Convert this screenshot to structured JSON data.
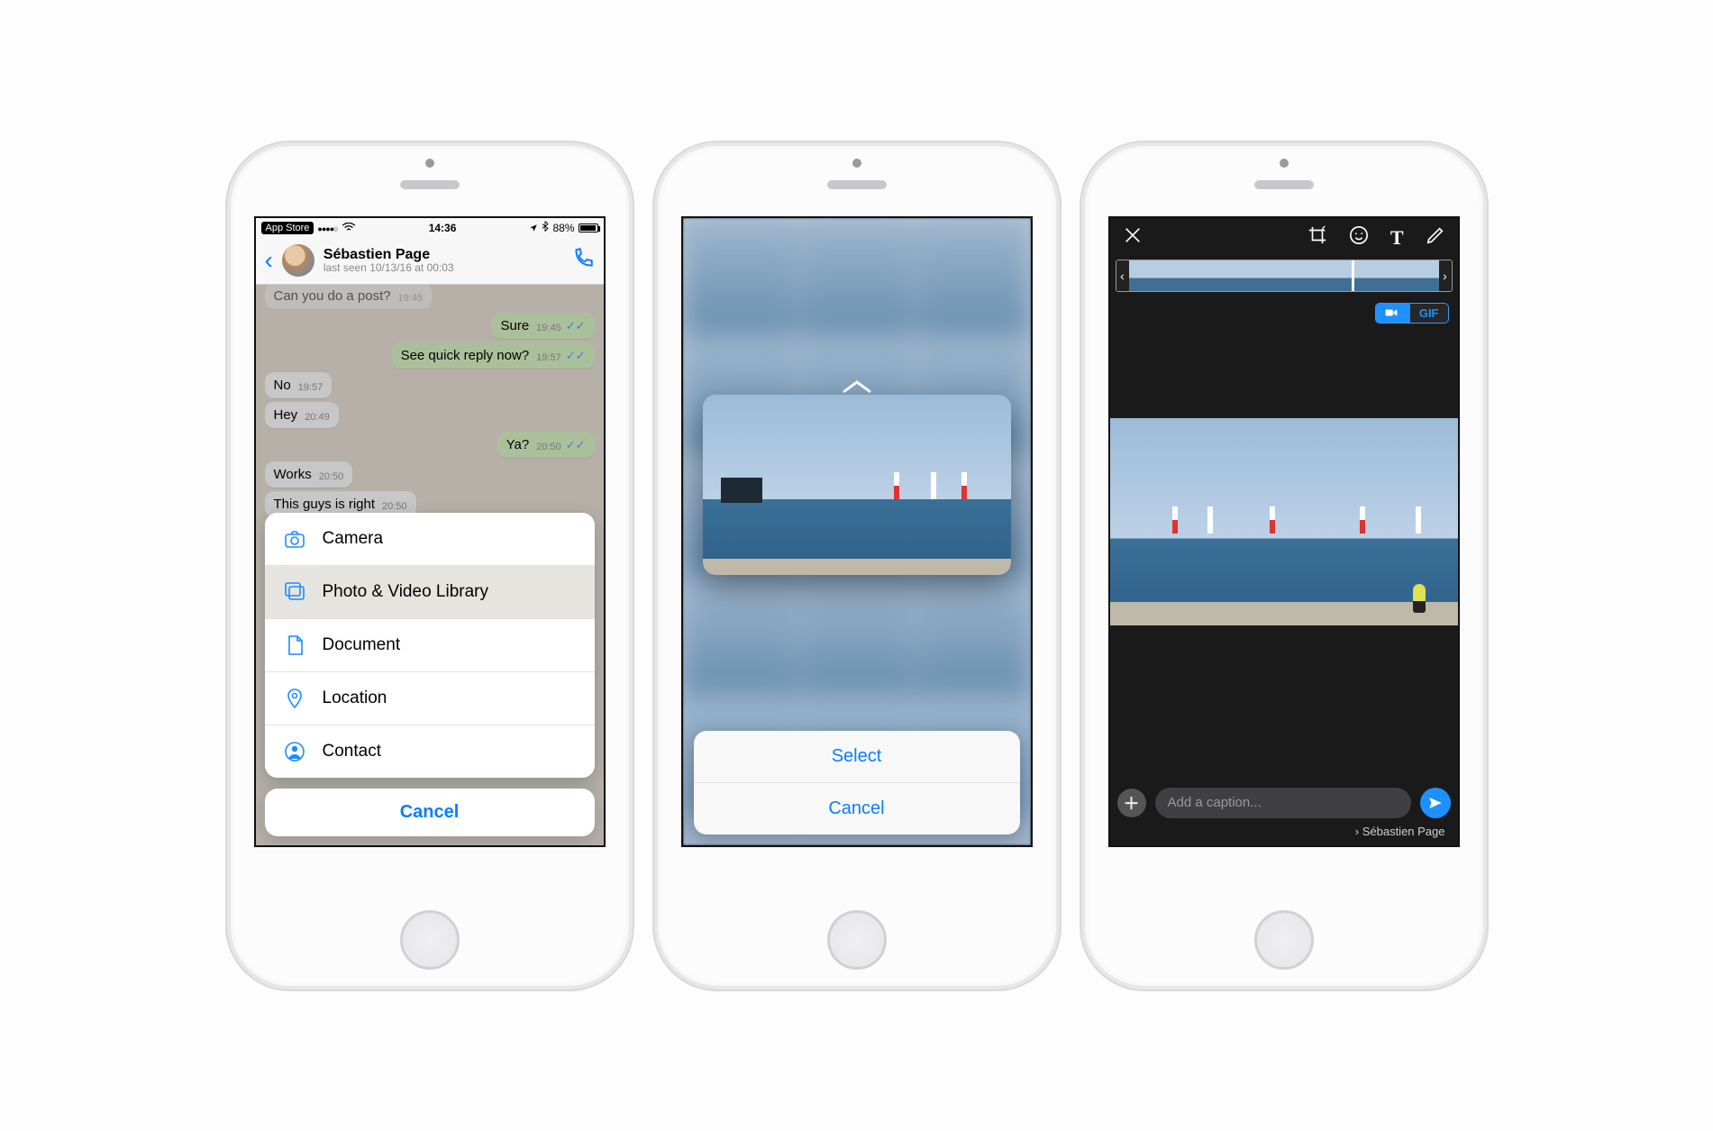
{
  "status_bar": {
    "back_app": "App Store",
    "time": "14:36",
    "battery_pct": "88%"
  },
  "chat_header": {
    "name": "Sébastien Page",
    "subtitle": "last seen 10/13/16 at 00:03"
  },
  "messages": {
    "m0_text": "Can you do a post?",
    "m0_time": "19:45",
    "m1_text": "Sure",
    "m1_time": "19:45",
    "m2_text": "See quick reply now?",
    "m2_time": "19:57",
    "m3_text": "No",
    "m3_time": "19:57",
    "m4_text": "Hey",
    "m4_time": "20:49",
    "m5_text": "Ya?",
    "m5_time": "20:50",
    "m6_text": "Works",
    "m6_time": "20:50",
    "m7_text": "This guys is right",
    "m7_time": "20:50"
  },
  "attachment_sheet": {
    "camera": "Camera",
    "library": "Photo & Video Library",
    "document": "Document",
    "location": "Location",
    "contact": "Contact",
    "cancel": "Cancel"
  },
  "preview_sheet": {
    "select": "Select",
    "cancel": "Cancel"
  },
  "gif_toggle": {
    "video": "",
    "gif": "GIF"
  },
  "editor": {
    "caption_placeholder": "Add a caption...",
    "recipient": "Sébastien Page"
  }
}
